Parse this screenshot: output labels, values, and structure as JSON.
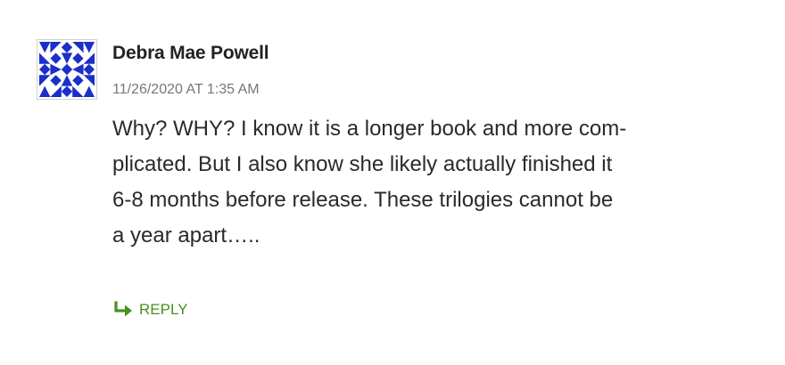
{
  "comment": {
    "author": "Debra Mae Powell",
    "timestamp": "11/26/2020 AT 1:35 AM",
    "body_lines": [
      "Why? WHY? I know it is a longer book and more com-",
      "plicated. But I also know she likely actually finished it",
      "6-8 months before release. These trilogies cannot be",
      "a year apart….."
    ],
    "reply_label": "REPLY",
    "reply_icon": "reply-arrow-icon",
    "avatar_icon": "geometric-identicon"
  },
  "colors": {
    "avatar": "#1c2fc9",
    "reply": "#4a8f23",
    "author": "#222222",
    "timestamp": "#777777"
  }
}
